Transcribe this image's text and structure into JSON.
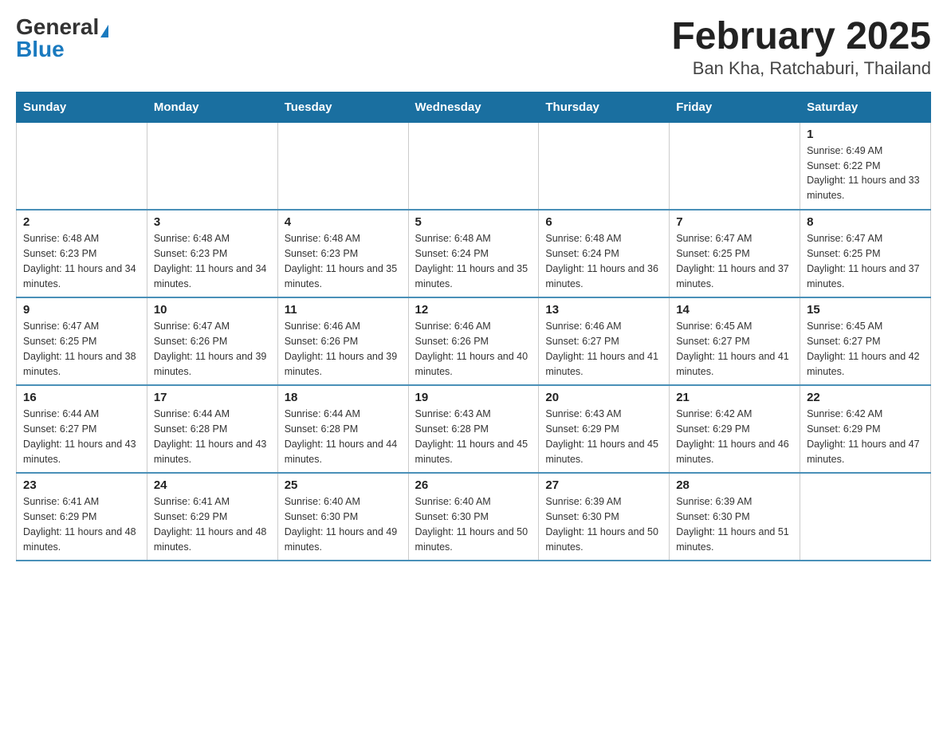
{
  "header": {
    "logo_general": "General",
    "logo_blue": "Blue",
    "title": "February 2025",
    "subtitle": "Ban Kha, Ratchaburi, Thailand"
  },
  "weekdays": [
    "Sunday",
    "Monday",
    "Tuesday",
    "Wednesday",
    "Thursday",
    "Friday",
    "Saturday"
  ],
  "weeks": [
    [
      {
        "day": "",
        "info": ""
      },
      {
        "day": "",
        "info": ""
      },
      {
        "day": "",
        "info": ""
      },
      {
        "day": "",
        "info": ""
      },
      {
        "day": "",
        "info": ""
      },
      {
        "day": "",
        "info": ""
      },
      {
        "day": "1",
        "info": "Sunrise: 6:49 AM\nSunset: 6:22 PM\nDaylight: 11 hours and 33 minutes."
      }
    ],
    [
      {
        "day": "2",
        "info": "Sunrise: 6:48 AM\nSunset: 6:23 PM\nDaylight: 11 hours and 34 minutes."
      },
      {
        "day": "3",
        "info": "Sunrise: 6:48 AM\nSunset: 6:23 PM\nDaylight: 11 hours and 34 minutes."
      },
      {
        "day": "4",
        "info": "Sunrise: 6:48 AM\nSunset: 6:23 PM\nDaylight: 11 hours and 35 minutes."
      },
      {
        "day": "5",
        "info": "Sunrise: 6:48 AM\nSunset: 6:24 PM\nDaylight: 11 hours and 35 minutes."
      },
      {
        "day": "6",
        "info": "Sunrise: 6:48 AM\nSunset: 6:24 PM\nDaylight: 11 hours and 36 minutes."
      },
      {
        "day": "7",
        "info": "Sunrise: 6:47 AM\nSunset: 6:25 PM\nDaylight: 11 hours and 37 minutes."
      },
      {
        "day": "8",
        "info": "Sunrise: 6:47 AM\nSunset: 6:25 PM\nDaylight: 11 hours and 37 minutes."
      }
    ],
    [
      {
        "day": "9",
        "info": "Sunrise: 6:47 AM\nSunset: 6:25 PM\nDaylight: 11 hours and 38 minutes."
      },
      {
        "day": "10",
        "info": "Sunrise: 6:47 AM\nSunset: 6:26 PM\nDaylight: 11 hours and 39 minutes."
      },
      {
        "day": "11",
        "info": "Sunrise: 6:46 AM\nSunset: 6:26 PM\nDaylight: 11 hours and 39 minutes."
      },
      {
        "day": "12",
        "info": "Sunrise: 6:46 AM\nSunset: 6:26 PM\nDaylight: 11 hours and 40 minutes."
      },
      {
        "day": "13",
        "info": "Sunrise: 6:46 AM\nSunset: 6:27 PM\nDaylight: 11 hours and 41 minutes."
      },
      {
        "day": "14",
        "info": "Sunrise: 6:45 AM\nSunset: 6:27 PM\nDaylight: 11 hours and 41 minutes."
      },
      {
        "day": "15",
        "info": "Sunrise: 6:45 AM\nSunset: 6:27 PM\nDaylight: 11 hours and 42 minutes."
      }
    ],
    [
      {
        "day": "16",
        "info": "Sunrise: 6:44 AM\nSunset: 6:27 PM\nDaylight: 11 hours and 43 minutes."
      },
      {
        "day": "17",
        "info": "Sunrise: 6:44 AM\nSunset: 6:28 PM\nDaylight: 11 hours and 43 minutes."
      },
      {
        "day": "18",
        "info": "Sunrise: 6:44 AM\nSunset: 6:28 PM\nDaylight: 11 hours and 44 minutes."
      },
      {
        "day": "19",
        "info": "Sunrise: 6:43 AM\nSunset: 6:28 PM\nDaylight: 11 hours and 45 minutes."
      },
      {
        "day": "20",
        "info": "Sunrise: 6:43 AM\nSunset: 6:29 PM\nDaylight: 11 hours and 45 minutes."
      },
      {
        "day": "21",
        "info": "Sunrise: 6:42 AM\nSunset: 6:29 PM\nDaylight: 11 hours and 46 minutes."
      },
      {
        "day": "22",
        "info": "Sunrise: 6:42 AM\nSunset: 6:29 PM\nDaylight: 11 hours and 47 minutes."
      }
    ],
    [
      {
        "day": "23",
        "info": "Sunrise: 6:41 AM\nSunset: 6:29 PM\nDaylight: 11 hours and 48 minutes."
      },
      {
        "day": "24",
        "info": "Sunrise: 6:41 AM\nSunset: 6:29 PM\nDaylight: 11 hours and 48 minutes."
      },
      {
        "day": "25",
        "info": "Sunrise: 6:40 AM\nSunset: 6:30 PM\nDaylight: 11 hours and 49 minutes."
      },
      {
        "day": "26",
        "info": "Sunrise: 6:40 AM\nSunset: 6:30 PM\nDaylight: 11 hours and 50 minutes."
      },
      {
        "day": "27",
        "info": "Sunrise: 6:39 AM\nSunset: 6:30 PM\nDaylight: 11 hours and 50 minutes."
      },
      {
        "day": "28",
        "info": "Sunrise: 6:39 AM\nSunset: 6:30 PM\nDaylight: 11 hours and 51 minutes."
      },
      {
        "day": "",
        "info": ""
      }
    ]
  ]
}
